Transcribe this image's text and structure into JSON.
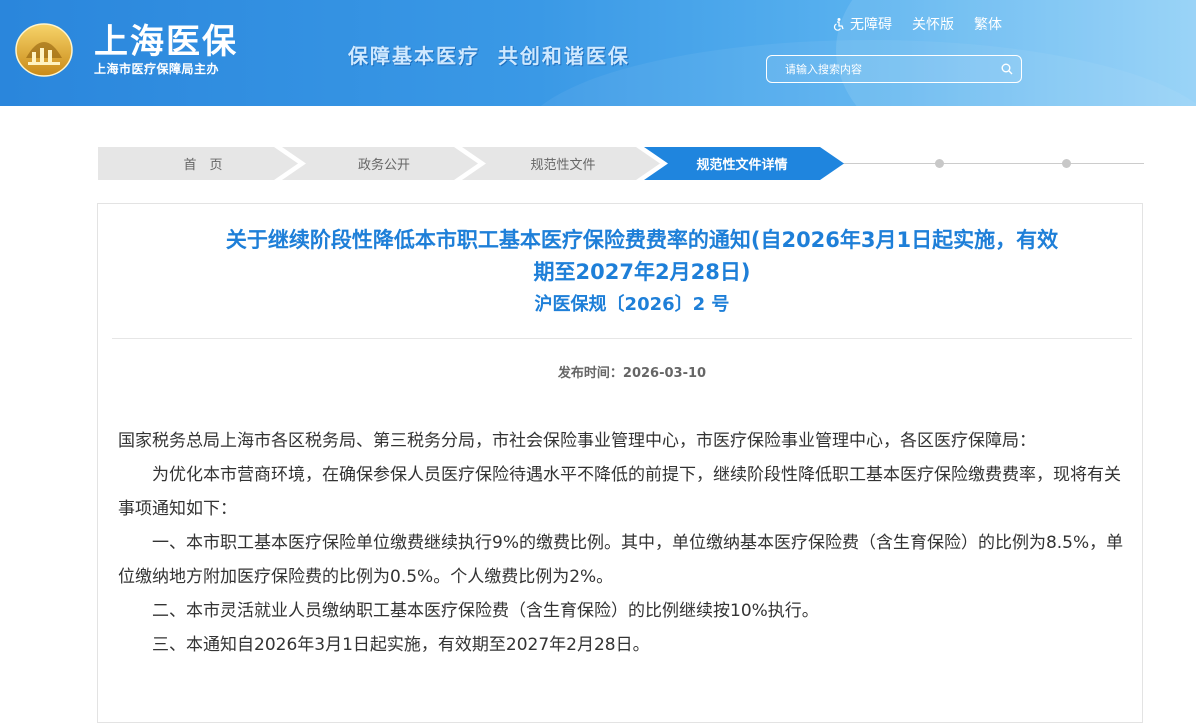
{
  "header": {
    "brand_title": "上海医保",
    "brand_sub": "上海市医疗保障局主办",
    "slogan": "保障基本医疗  共创和谐医保",
    "accessibility_label": "无障碍",
    "care_mode_label": "关怀版",
    "traditional_label": "繁体",
    "search_placeholder": "请输入搜索内容"
  },
  "breadcrumb": {
    "items": [
      "首　页",
      "政务公开",
      "规范性文件",
      "规范性文件详情"
    ]
  },
  "article": {
    "title_line1": "关于继续阶段性降低本市职工基本医疗保险费费率的通知(自2026年3月1日起实施，有效",
    "title_line2": "期至2027年2月28日)",
    "doc_number": "沪医保规〔2026〕2 号",
    "publish_label": "发布时间：",
    "publish_date": "2026-03-10",
    "recipients": "国家税务总局上海市各区税务局、第三税务分局，市社会保险事业管理中心，市医疗保险事业管理中心，各区医疗保障局：",
    "paragraphs": [
      "为优化本市营商环境，在确保参保人员医疗保险待遇水平不降低的前提下，继续阶段性降低职工基本医疗保险缴费费率，现将有关事项通知如下：",
      "一、本市职工基本医疗保险单位缴费继续执行9%的缴费比例。其中，单位缴纳基本医疗保险费（含生育保险）的比例为8.5%，单位缴纳地方附加医疗保险费的比例为0.5%。个人缴费比例为2%。",
      "二、本市灵活就业人员缴纳职工基本医疗保险费（含生育保险）的比例继续按10%执行。",
      "三、本通知自2026年3月1日起实施，有效期至2027年2月28日。"
    ]
  },
  "colors": {
    "header_blue": "#2a86dc",
    "title_blue": "#1e7fd8",
    "crumb_active": "#1f85de",
    "crumb_inactive": "#e5e5e5"
  },
  "icons": [
    "logo-emblem-icon",
    "accessibility-icon",
    "search-icon"
  ]
}
